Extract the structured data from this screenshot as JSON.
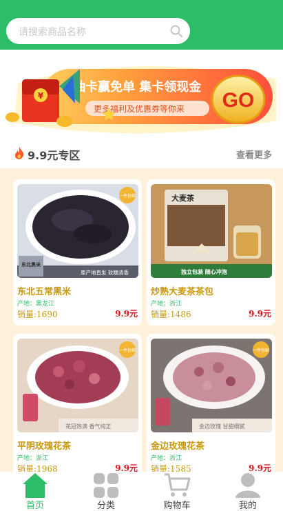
{
  "search": {
    "placeholder": "请搜索商品名称"
  },
  "banner": {
    "headline": "抽卡赢免单 集卡领现金",
    "subline": "更多福利及优惠券等你来",
    "go": "GO",
    "coin": "¥"
  },
  "section": {
    "title": "9.9元专区",
    "more": "查看更多"
  },
  "products": [
    {
      "name": "东北五常黑米",
      "origin": "产地：黑龙江",
      "sales": "销量:1690",
      "price": "9.9元",
      "badge": "一件包邮",
      "corner": "东北黑米",
      "strip": "原产地直发 软糯清香"
    },
    {
      "name": "炒熟大麦茶茶包",
      "origin": "产地：浙江",
      "sales": "销量:1486",
      "price": "9.9元",
      "pkg": "大麦茶",
      "strip": "独立包装 随心冲泡"
    },
    {
      "name": "平阴玫瑰花茶",
      "origin": "产地：浙江",
      "sales": "销量:1968",
      "price": "9.9元",
      "badge": "一件包邮",
      "strip": "花冠饱满 香气纯正"
    },
    {
      "name": "金边玫瑰花茶",
      "origin": "产地：浙江",
      "sales": "销量:1585",
      "price": "9.9元",
      "badge": "一件包邮",
      "strip": "金边玫瑰 甘甜细腻"
    }
  ],
  "tabs": [
    {
      "label": "首页",
      "icon": "home-icon",
      "active": true
    },
    {
      "label": "分类",
      "icon": "category-icon"
    },
    {
      "label": "购物车",
      "icon": "cart-icon"
    },
    {
      "label": "我的",
      "icon": "user-icon"
    }
  ],
  "colors": {
    "brand": "#2dbd68",
    "price": "#e0101a",
    "gold": "#c9980e",
    "grid_bg": "#fff0d9"
  }
}
